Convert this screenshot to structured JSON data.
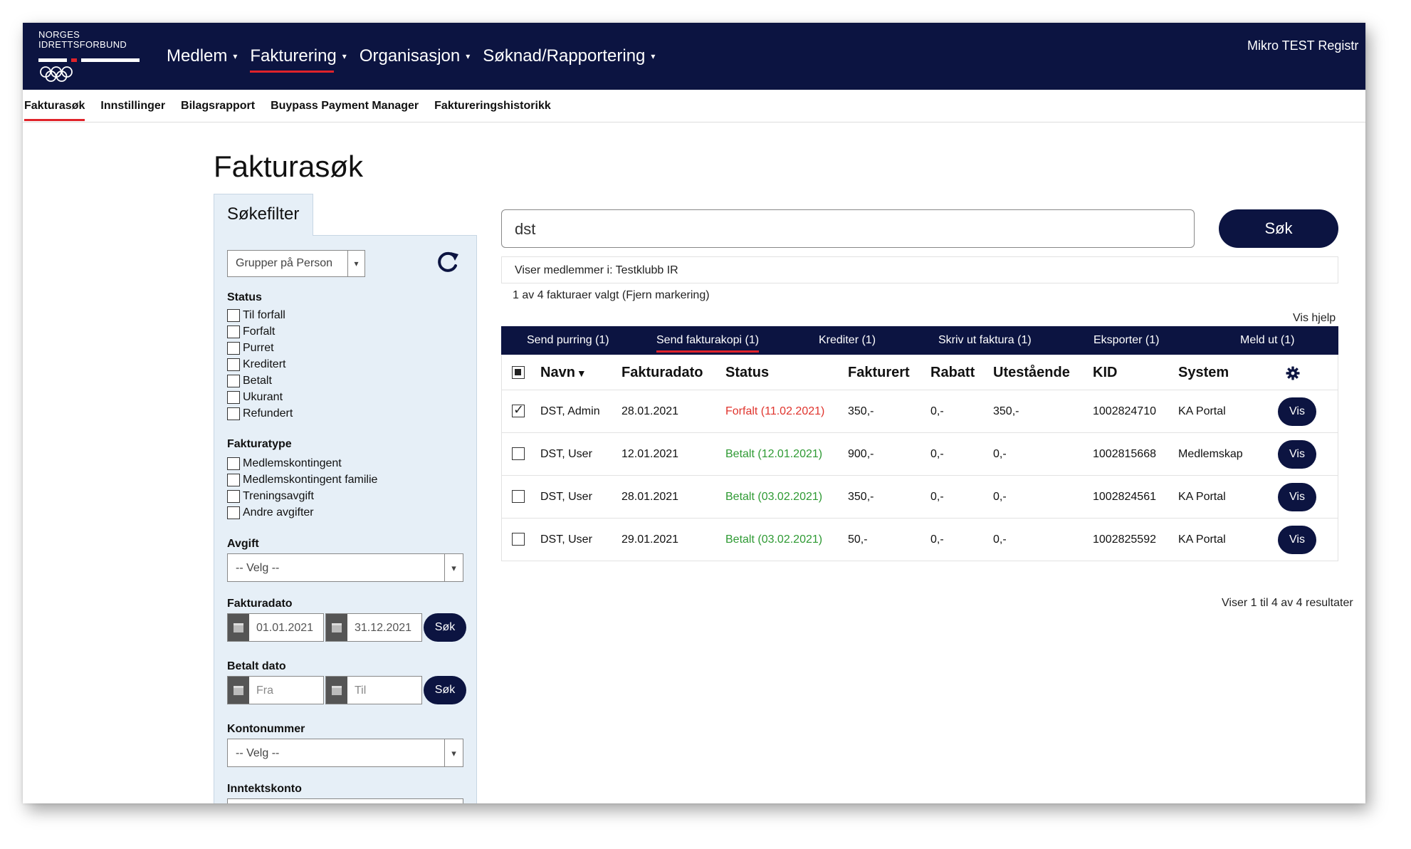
{
  "logo": {
    "line1": "NORGES",
    "line2": "IDRETTSFORBUND"
  },
  "topnav": {
    "items": [
      {
        "label": "Medlem",
        "active": false
      },
      {
        "label": "Fakturering",
        "active": true
      },
      {
        "label": "Organisasjon",
        "active": false
      },
      {
        "label": "Søknad/Rapportering",
        "active": false
      }
    ],
    "user": "Mikro TEST Registr"
  },
  "subnav": {
    "items": [
      {
        "label": "Fakturasøk",
        "active": true
      },
      {
        "label": "Innstillinger",
        "active": false
      },
      {
        "label": "Bilagsrapport",
        "active": false
      },
      {
        "label": "Buypass Payment Manager",
        "active": false
      },
      {
        "label": "Faktureringshistorikk",
        "active": false
      }
    ]
  },
  "page_title": "Fakturasøk",
  "filter": {
    "tab_label": "Søkefilter",
    "group_select": "Grupper på Person",
    "status": {
      "heading": "Status",
      "options": [
        "Til forfall",
        "Forfalt",
        "Purret",
        "Kreditert",
        "Betalt",
        "Ukurant",
        "Refundert"
      ]
    },
    "fakturatype": {
      "heading": "Fakturatype",
      "options": [
        "Medlemskontingent",
        "Medlemskontingent familie",
        "Treningsavgift",
        "Andre avgifter"
      ]
    },
    "avgift": {
      "heading": "Avgift",
      "value": "-- Velg --"
    },
    "fakturadato": {
      "heading": "Fakturadato",
      "from": "01.01.2021",
      "to": "31.12.2021",
      "button": "Søk"
    },
    "betalt_dato": {
      "heading": "Betalt dato",
      "from_placeholder": "Fra",
      "to_placeholder": "Til",
      "button": "Søk"
    },
    "kontonummer": {
      "heading": "Kontonummer",
      "value": "-- Velg --"
    },
    "inntektskonto": {
      "heading": "Inntektskonto"
    }
  },
  "search": {
    "value": "dst",
    "button": "Søk"
  },
  "info": {
    "members": "Viser medlemmer i: Testklubb IR",
    "selection": "1 av 4 fakturaer valgt (Fjern markering)",
    "help": "Vis hjelp"
  },
  "actions": [
    {
      "label": "Send purring (1)",
      "active": false
    },
    {
      "label": "Send fakturakopi (1)",
      "active": true
    },
    {
      "label": "Krediter (1)",
      "active": false
    },
    {
      "label": "Skriv ut faktura (1)",
      "active": false
    },
    {
      "label": "Eksporter (1)",
      "active": false
    },
    {
      "label": "Meld ut (1)",
      "active": false
    }
  ],
  "table": {
    "headers": {
      "navn": "Navn",
      "fakturadato": "Fakturadato",
      "status": "Status",
      "fakturert": "Fakturert",
      "rabatt": "Rabatt",
      "utestaende": "Utestående",
      "kid": "KID",
      "system": "System"
    },
    "rows": [
      {
        "checked": true,
        "navn": "DST, Admin",
        "fakturadato": "28.01.2021",
        "status": "Forfalt (11.02.2021)",
        "status_type": "red",
        "fakturert": "350,-",
        "rabatt": "0,-",
        "utestaende": "350,-",
        "kid": "1002824710",
        "system": "KA Portal",
        "button": "Vis"
      },
      {
        "checked": false,
        "navn": "DST, User",
        "fakturadato": "12.01.2021",
        "status": "Betalt (12.01.2021)",
        "status_type": "green",
        "fakturert": "900,-",
        "rabatt": "0,-",
        "utestaende": "0,-",
        "kid": "1002815668",
        "system": "Medlemskap",
        "button": "Vis"
      },
      {
        "checked": false,
        "navn": "DST, User",
        "fakturadato": "28.01.2021",
        "status": "Betalt (03.02.2021)",
        "status_type": "green",
        "fakturert": "350,-",
        "rabatt": "0,-",
        "utestaende": "0,-",
        "kid": "1002824561",
        "system": "KA Portal",
        "button": "Vis"
      },
      {
        "checked": false,
        "navn": "DST, User",
        "fakturadato": "29.01.2021",
        "status": "Betalt (03.02.2021)",
        "status_type": "green",
        "fakturert": "50,-",
        "rabatt": "0,-",
        "utestaende": "0,-",
        "kid": "1002825592",
        "system": "KA Portal",
        "button": "Vis"
      }
    ],
    "result_info": "Viser 1 til 4 av 4 resultater"
  },
  "colors": {
    "navy": "#0c1441",
    "accent_red": "#e0232a",
    "status_red": "#e0342d",
    "status_green": "#2e9a33",
    "filter_bg": "#e6eff7"
  },
  "icons": {
    "refresh": "refresh-icon",
    "calendar": "calendar-icon",
    "gear": "gear-icon",
    "sort": "caret-down-icon"
  }
}
